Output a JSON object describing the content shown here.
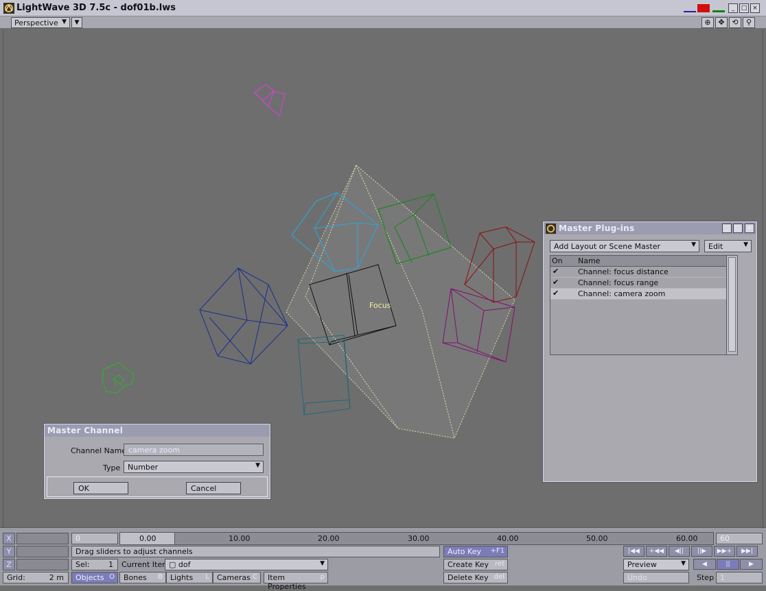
{
  "window": {
    "title": "LightWave 3D 7.5c - dof01b.lws",
    "buttons": [
      "_",
      "□",
      "×"
    ]
  },
  "viewport": {
    "view_mode": "Perspective",
    "focus_label": "Focus",
    "nav_icons": [
      "⊕",
      "✥",
      "⟲",
      "⚲"
    ]
  },
  "master_channel": {
    "title": "Master Channel",
    "channel_name_label": "Channel Name",
    "channel_name_value": "camera zoom",
    "type_label": "Type",
    "type_value": "Number",
    "ok_label": "OK",
    "cancel_label": "Cancel"
  },
  "master_plugins": {
    "title": "Master Plug-ins",
    "add_label": "Add Layout or Scene Master",
    "edit_label": "Edit",
    "col_on": "On",
    "col_name": "Name",
    "rows": [
      {
        "check": "✔",
        "name": "Channel: focus distance"
      },
      {
        "check": "✔",
        "name": "Channel:  focus range"
      },
      {
        "check": "✔",
        "name": "Channel:  camera zoom"
      }
    ]
  },
  "bottom": {
    "axes": [
      "X",
      "Y",
      "Z"
    ],
    "frame_start": "0",
    "frame_end": "60",
    "ticks": [
      "0.00",
      "10.00",
      "20.00",
      "30.00",
      "40.00",
      "50.00",
      "60.00"
    ],
    "status": "Drag sliders to adjust channels",
    "sel_label": "Sel:",
    "sel_value": "1",
    "current_item_label": "Current Item",
    "current_item_value": "dof",
    "grid_label": "Grid:",
    "grid_value": "2 m",
    "modes": [
      {
        "label": "Objects",
        "key": "O"
      },
      {
        "label": "Bones",
        "key": "B"
      },
      {
        "label": "Lights",
        "key": "L"
      },
      {
        "label": "Cameras",
        "key": "C"
      }
    ],
    "item_properties": {
      "label": "Item Properties",
      "key": "p"
    },
    "auto_key": {
      "label": "Auto Key",
      "key": "+F1"
    },
    "create_key": {
      "label": "Create Key",
      "key": "ret"
    },
    "delete_key": {
      "label": "Delete Key",
      "key": "del"
    },
    "transport": [
      "|◀◀",
      "+◀◀",
      "◀||",
      "||▶",
      "▶▶+",
      "▶▶|"
    ],
    "preview_label": "Preview",
    "play_buttons": [
      "◀",
      "||",
      "▶"
    ],
    "undo_label": "Undo",
    "step_label": "Step",
    "step_value": "1"
  }
}
